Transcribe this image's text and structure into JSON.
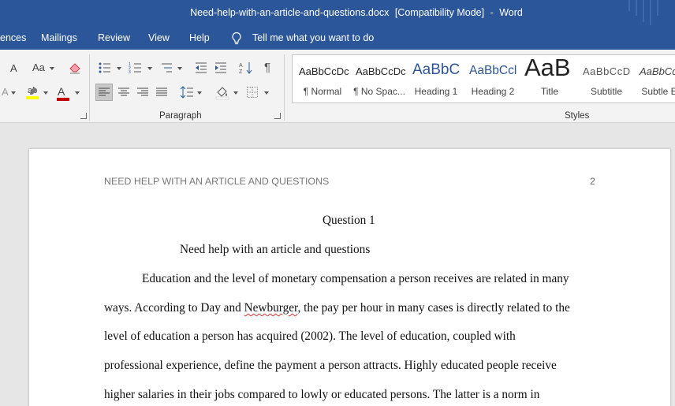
{
  "titlebar": {
    "filename": "Need-help-with-an-article-and-questions.docx",
    "mode": "[Compatibility Mode]",
    "separator": "-",
    "app": "Word"
  },
  "tabs": {
    "references": "ences",
    "mailings": "Mailings",
    "review": "Review",
    "view": "View",
    "help": "Help",
    "tell_me": "Tell me what you want to do"
  },
  "ribbon": {
    "font_group": {
      "grow_font": "A",
      "change_case": "Aa",
      "clear_format_icon": "eraser-icon",
      "text_effects": "A",
      "highlight_color": "#ffff00",
      "font_color_glyph": "A",
      "font_color": "#c00000"
    },
    "paragraph_group": {
      "label": "Paragraph",
      "pilcrow": "¶"
    },
    "styles_group": {
      "label": "Styles",
      "items": [
        {
          "sample": "AaBbCcDc",
          "name": "¶ Normal"
        },
        {
          "sample": "AaBbCcDc",
          "name": "¶ No Spac..."
        },
        {
          "sample": "AaBbC",
          "name": "Heading 1"
        },
        {
          "sample": "AaBbCcl",
          "name": "Heading 2"
        },
        {
          "sample": "AaB",
          "name": "Title"
        },
        {
          "sample": "AaBbCcD",
          "name": "Subtitle"
        },
        {
          "sample": "AaBbCcl",
          "name": "Subtle Em"
        }
      ],
      "colors": {
        "heading1": "#2f5597",
        "heading2": "#2f5597",
        "subtitle": "#595959"
      }
    }
  },
  "document": {
    "header": "NEED HELP WITH AN ARTICLE AND QUESTIONS",
    "page_number": "2",
    "heading": "Question 1",
    "subheading": "Need help with an article and questions",
    "lines": {
      "l1": "Education and the level of monetary compensation a person receives are related in many",
      "l2_a": "ways. According to Day and ",
      "l2_b": "Newburger",
      "l2_c": ", the pay per hour in many cases is directly related to the",
      "l3": "level of education a person has acquired (2002). The level of education, coupled with",
      "l4": "professional experience, define the payment a person attracts. Highly educated people receive",
      "l5": "higher salaries in their jobs compared to lowly or educated persons. The latter is a norm in"
    }
  }
}
